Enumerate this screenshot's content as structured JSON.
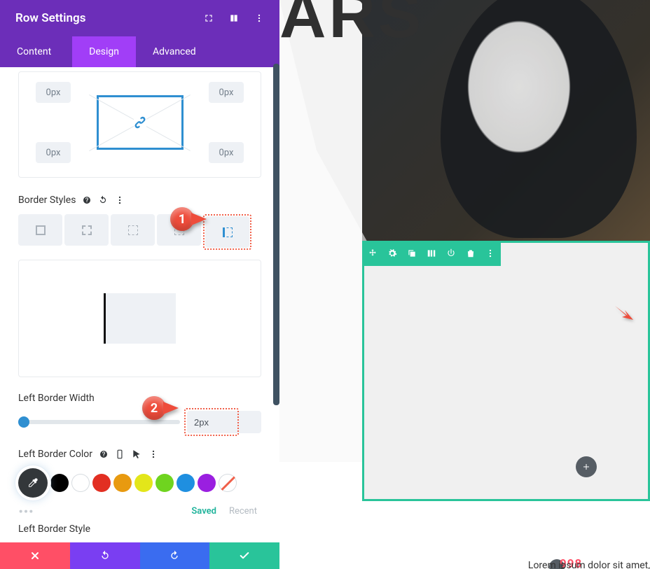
{
  "header": {
    "title": "Row Settings"
  },
  "tabs": {
    "content": "Content",
    "design": "Design",
    "advanced": "Advanced",
    "active": "design"
  },
  "spacing": {
    "tl": "0px",
    "tr": "0px",
    "bl": "0px",
    "br": "0px"
  },
  "border_styles": {
    "label": "Border Styles"
  },
  "left_border_width": {
    "label": "Left Border Width",
    "value": "2px"
  },
  "left_border_color": {
    "label": "Left Border Color",
    "swatches": [
      "#000000",
      "#ffffff",
      "#e22f22",
      "#e89a10",
      "#e3e61a",
      "#6fd41f",
      "#1f8fe0",
      "#9a1fe0"
    ],
    "saved": "Saved",
    "recent": "Recent"
  },
  "left_border_style": {
    "label": "Left Border Style"
  },
  "callouts": {
    "one": "1",
    "two": "2"
  },
  "preview": {
    "title": "ARS",
    "year": "998",
    "lorem": "Lorem ipsum dolor sit amet,"
  }
}
